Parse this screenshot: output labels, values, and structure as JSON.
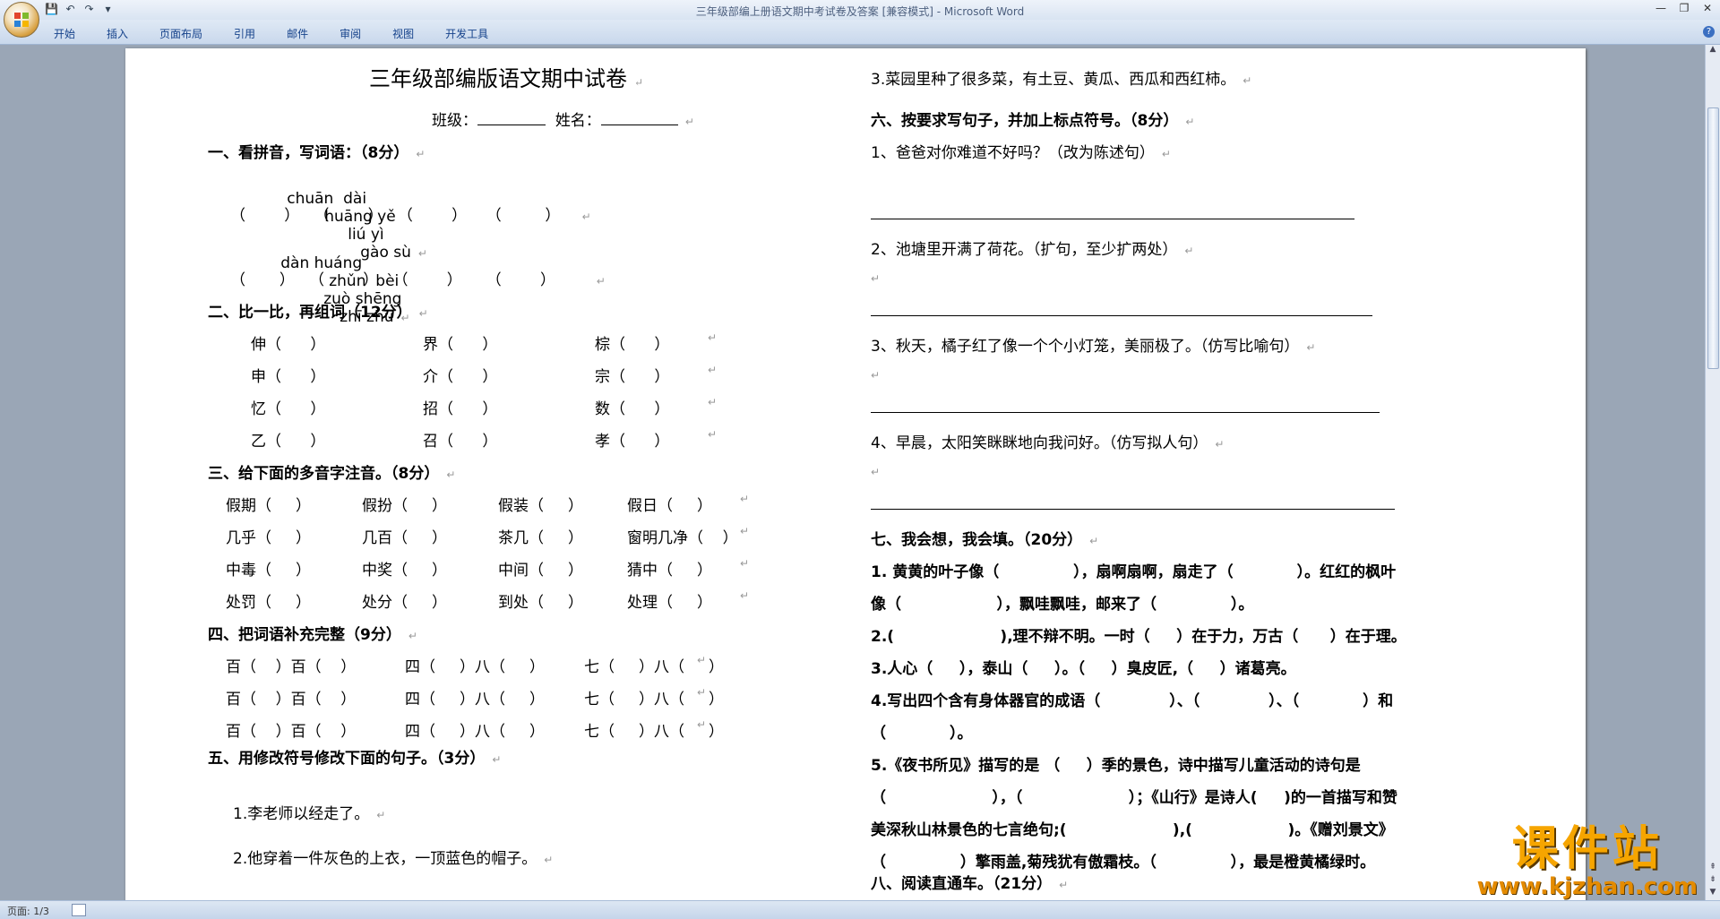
{
  "window": {
    "title": "三年级部编上册语文期中考试卷及答案 [兼容模式] - Microsoft Word"
  },
  "ribbon": {
    "tabs": [
      "开始",
      "插入",
      "页面布局",
      "引用",
      "邮件",
      "审阅",
      "视图",
      "开发工具"
    ]
  },
  "status": {
    "page": "页面: 1/3"
  },
  "watermark": {
    "name": "课件站",
    "url": "www.kjzhan.com"
  },
  "doc": {
    "title": "三年级部编版语文期中试卷",
    "class_label": "班级：",
    "name_label": "姓名：",
    "s1": {
      "heading": "一、看拼音，写词语：（8分）",
      "pinyin_row1": [
        "chuān  dài",
        "huāng yě",
        "liú yì",
        "gào sù"
      ],
      "pinyin_row2": [
        "dàn huáng",
        "zhǔn  bèi",
        "zuò shēng",
        "zhī zhū"
      ]
    },
    "s2": {
      "heading": "二、比一比，再组词（12分）",
      "rows": [
        [
          "伸（      ）",
          "界（      ）",
          "棕（      ）"
        ],
        [
          "申（      ）",
          "介（      ）",
          "宗（      ）"
        ],
        [
          "忆（      ）",
          "招（      ）",
          "数（      ）"
        ],
        [
          "乙（      ）",
          "召（      ）",
          "孝（      ）"
        ]
      ]
    },
    "s3": {
      "heading": "三、给下面的多音字注音。（8分）",
      "rows": [
        [
          "假期（     ）",
          "假扮（     ）",
          "假装（     ）",
          "假日（     ）"
        ],
        [
          "几乎（     ）",
          "几百（     ）",
          "茶几（     ）",
          "窗明几净（    ）"
        ],
        [
          "中毒（     ）",
          "中奖（     ）",
          "中间（     ）",
          "猜中（     ）"
        ],
        [
          "处罚（     ）",
          "处分（     ）",
          "到处（     ）",
          "处理（     ）"
        ]
      ]
    },
    "s4": {
      "heading": "四、把词语补充完整（9分）",
      "rows": [
        [
          "百（    ）百（    ）",
          "四（     ）八（     ）",
          "七（     ）八（     ）"
        ],
        [
          "百（    ）百（    ）",
          "四（     ）八（     ）",
          "七（     ）八（     ）"
        ],
        [
          "百（    ）百（    ）",
          "四（     ）八（     ）",
          "七（     ）八（     ）"
        ]
      ]
    },
    "s5": {
      "heading": "五、用修改符号修改下面的句子。（3分）",
      "items": [
        "1.李老师以经走了。",
        "2.他穿着一件灰色的上衣，一顶蓝色的帽子。"
      ]
    },
    "s5_cont": "3.菜园里种了很多菜，有土豆、黄瓜、西瓜和西红柿。",
    "s6": {
      "heading": "六、按要求写句子，并加上标点符号。（8分）",
      "items": [
        "1、爸爸对你难道不好吗？（改为陈述句）",
        "2、池塘里开满了荷花。（扩句，至少扩两处）",
        "3、秋天，橘子红了像一个个小灯笼，美丽极了。（仿写比喻句）",
        "4、早晨，太阳笑眯眯地向我问好。（仿写拟人句）"
      ]
    },
    "s7": {
      "heading": "七、我会想，我会填。（20分）",
      "lines": [
        "1. 黄黄的叶子像（              ），扇啊扇啊，扇走了（            ）。红红的枫叶",
        "像（                  ），飘哇飘哇，邮来了（              ）。",
        "2.(                    ),理不辩不明。一时（     ）在于力，万古（      ）在于理。",
        "3.人心（     ），泰山（     ）。（     ）臭皮匠,（     ）诸葛亮。",
        "4.写出四个含有身体器官的成语（             ）、（             ）、（            ）和",
        "（            ）。",
        "5.《夜书所见》描写的是 （     ）季的景色，诗中描写儿童活动的诗句是",
        "（                    ），（                    ）；《山行》是诗人(     )的一首描写和赞",
        "美深秋山林景色的七言绝句;(                    ),(                  )。《赠刘景文》",
        "（              ）擎雨盖,菊残犹有傲霜枝。（              ），最是橙黄橘绿时。"
      ]
    },
    "s8": {
      "heading": "八、阅读直通车。（21分）"
    }
  }
}
